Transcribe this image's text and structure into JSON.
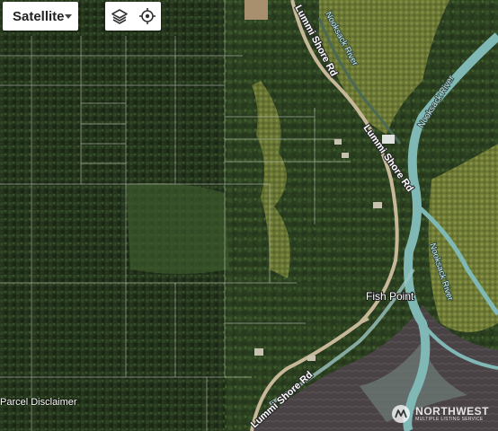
{
  "map_type": {
    "selected": "Satellite"
  },
  "labels": {
    "roads": [
      "Lummi Shore Rd",
      "Lummi Shore Rd",
      "Lummi Shore Rd"
    ],
    "rivers": [
      "Nooksack River",
      "Nooksack River",
      "Nooksack River"
    ],
    "place": "Fish Point"
  },
  "disclaimer": "Parcel Disclaimer",
  "brand": {
    "name": "NORTHWEST",
    "tagline": "MULTIPLE LISTING SERVICE"
  },
  "icons": {
    "layers": "layers-icon",
    "locate": "crosshair-icon",
    "brand": "nwmls-logo-icon",
    "dropdown": "caret-down-icon"
  },
  "colors": {
    "forest": "#23331c",
    "grass": "#7d8a3c",
    "river": "#7fb8b5",
    "tidal_flat": "#4c4648",
    "parcel_lines": "#c9d2c2"
  }
}
